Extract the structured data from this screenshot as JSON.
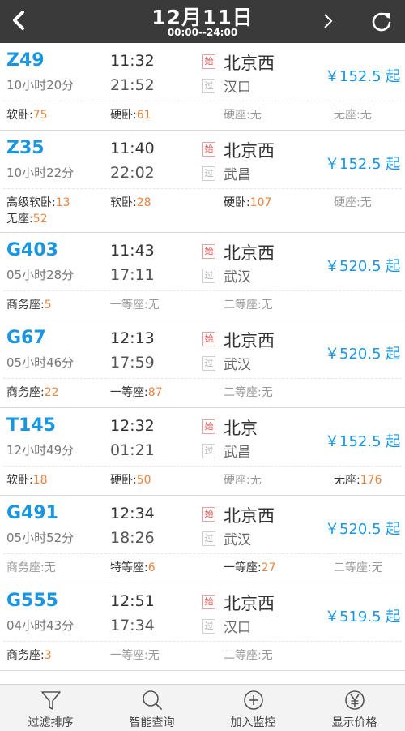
{
  "header": {
    "title": "12月11日",
    "subtitle": "00:00--24:00"
  },
  "trains": [
    {
      "number": "Z49",
      "duration": "10小时20分",
      "depart": "11:32",
      "arrive": "21:52",
      "start_tag": "始",
      "pass_tag": "过",
      "from": "北京西",
      "to": "汉口",
      "price": "￥152.5 起",
      "seats": [
        {
          "name": "软卧:",
          "value": "75"
        },
        {
          "name": "硬卧:",
          "value": "61"
        },
        {
          "name": "硬座:",
          "value": "无"
        },
        {
          "name": "无座:",
          "value": "无"
        }
      ]
    },
    {
      "number": "Z35",
      "duration": "10小时22分",
      "depart": "11:40",
      "arrive": "22:02",
      "start_tag": "始",
      "pass_tag": "过",
      "from": "北京西",
      "to": "武昌",
      "price": "￥152.5 起",
      "seats": [
        {
          "name": "高级软卧:",
          "value": "13"
        },
        {
          "name": "软卧:",
          "value": "28"
        },
        {
          "name": "硬卧:",
          "value": "107"
        },
        {
          "name": "硬座:",
          "value": "无"
        },
        {
          "name": "无座:",
          "value": "52"
        }
      ]
    },
    {
      "number": "G403",
      "duration": "05小时28分",
      "depart": "11:43",
      "arrive": "17:11",
      "start_tag": "始",
      "pass_tag": "过",
      "from": "北京西",
      "to": "武汉",
      "price": "￥520.5 起",
      "seats": [
        {
          "name": "商务座:",
          "value": "5"
        },
        {
          "name": "一等座:",
          "value": "无"
        },
        {
          "name": "二等座:",
          "value": "无"
        }
      ]
    },
    {
      "number": "G67",
      "duration": "05小时46分",
      "depart": "12:13",
      "arrive": "17:59",
      "start_tag": "始",
      "pass_tag": "过",
      "from": "北京西",
      "to": "武汉",
      "price": "￥520.5 起",
      "seats": [
        {
          "name": "商务座:",
          "value": "22"
        },
        {
          "name": "一等座:",
          "value": "87"
        },
        {
          "name": "二等座:",
          "value": "无"
        }
      ]
    },
    {
      "number": "T145",
      "duration": "12小时49分",
      "depart": "12:32",
      "arrive": "01:21",
      "start_tag": "始",
      "pass_tag": "过",
      "from": "北京",
      "to": "武昌",
      "price": "￥152.5 起",
      "seats": [
        {
          "name": "软卧:",
          "value": "18"
        },
        {
          "name": "硬卧:",
          "value": "50"
        },
        {
          "name": "硬座:",
          "value": "无"
        },
        {
          "name": "无座:",
          "value": "176"
        }
      ]
    },
    {
      "number": "G491",
      "duration": "05小时52分",
      "depart": "12:34",
      "arrive": "18:26",
      "start_tag": "始",
      "pass_tag": "过",
      "from": "北京西",
      "to": "武汉",
      "price": "￥520.5 起",
      "seats": [
        {
          "name": "商务座:",
          "value": "无"
        },
        {
          "name": "特等座:",
          "value": "6"
        },
        {
          "name": "一等座:",
          "value": "27"
        },
        {
          "name": "二等座:",
          "value": "无"
        }
      ]
    },
    {
      "number": "G555",
      "duration": "04小时43分",
      "depart": "12:51",
      "arrive": "17:34",
      "start_tag": "始",
      "pass_tag": "过",
      "from": "北京西",
      "to": "汉口",
      "price": "￥519.5 起",
      "seats": [
        {
          "name": "商务座:",
          "value": "3"
        },
        {
          "name": "一等座:",
          "value": "无"
        },
        {
          "name": "二等座:",
          "value": "无"
        }
      ]
    }
  ],
  "bottom_bar": [
    {
      "label": "过滤排序",
      "icon": "filter-icon"
    },
    {
      "label": "智能查询",
      "icon": "search-icon"
    },
    {
      "label": "加入监控",
      "icon": "add-circle-icon"
    },
    {
      "label": "显示价格",
      "icon": "yen-circle-icon"
    }
  ],
  "colors": {
    "accent": "#1a96e0",
    "header_bg": "#3a3a3a",
    "available_count": "#e8843e",
    "start_tag": "#e05555"
  }
}
